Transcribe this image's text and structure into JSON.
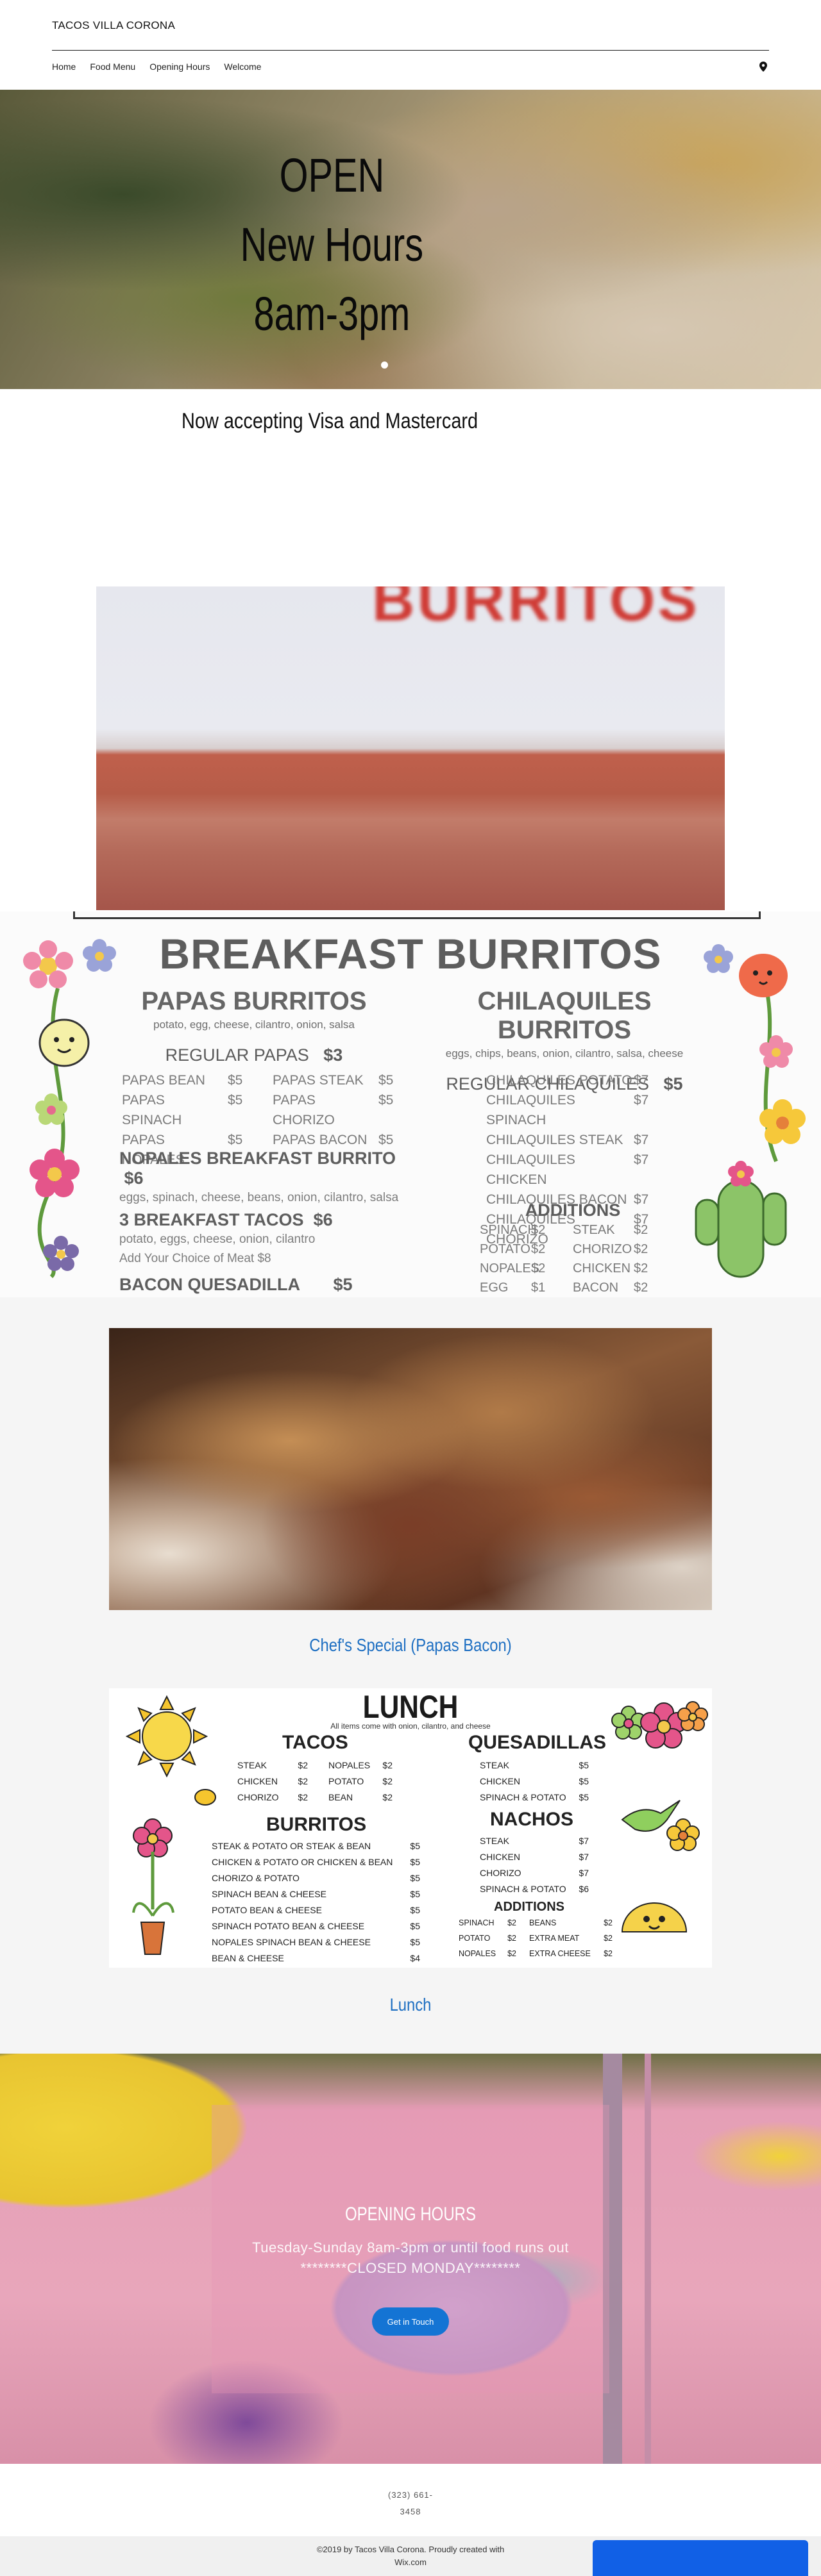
{
  "header": {
    "brand": "TACOS VILLA CORONA",
    "nav": [
      "Home",
      "Food Menu",
      "Opening Hours",
      "Welcome"
    ],
    "map_icon": "map-pin-icon"
  },
  "hero": {
    "line1": "OPEN",
    "line2": "New Hours",
    "line3": "8am-3pm"
  },
  "notice": "Now accepting Visa and Mastercard",
  "sign_image": {
    "word": "BURRITOS"
  },
  "breakfast_menu": {
    "title": "BREAKFAST BURRITOS",
    "papas": {
      "heading": "PAPAS BURRITOS",
      "note": "potato, egg, cheese, cilantro, onion, salsa",
      "sub_heading": "REGULAR PAPAS",
      "sub_price": "$3",
      "items_left": [
        {
          "name": "PAPAS BEAN",
          "price": "$5"
        },
        {
          "name": "PAPAS SPINACH",
          "price": "$5"
        },
        {
          "name": "PAPAS NOPALES",
          "price": "$5"
        }
      ],
      "items_right": [
        {
          "name": "PAPAS STEAK",
          "price": "$5"
        },
        {
          "name": "PAPAS CHORIZO",
          "price": "$5"
        },
        {
          "name": "PAPAS BACON",
          "price": "$5"
        }
      ],
      "nopales_name": "NOPALES BREAKFAST BURRITO",
      "nopales_price": "$6",
      "nopales_note": "eggs, spinach, cheese, beans, onion, cilantro, salsa",
      "tacos_name": "3 BREAKFAST TACOS",
      "tacos_price": "$6",
      "tacos_note1": "potato, eggs, cheese, onion, cilantro",
      "tacos_note2": "Add Your Choice of Meat $8",
      "quesadilla_name": "BACON QUESADILLA",
      "quesadilla_price": "$5"
    },
    "chilaquiles": {
      "heading": "CHILAQUILES BURRITOS",
      "note": "eggs, chips, beans, onion, cilantro, salsa, cheese",
      "sub_heading": "REGULAR CHILAQUILES",
      "sub_price": "$5",
      "items": [
        {
          "name": "CHILAQUILES POTATO",
          "price": "$7"
        },
        {
          "name": "CHILAQUILES SPINACH",
          "price": "$7"
        },
        {
          "name": "CHILAQUILES STEAK",
          "price": "$7"
        },
        {
          "name": "CHILAQUILES CHICKEN",
          "price": "$7"
        },
        {
          "name": "CHILAQUILES BACON",
          "price": "$7"
        },
        {
          "name": "CHILAQUILES CHORIZO",
          "price": "$7"
        }
      ],
      "additions_title": "ADDITIONS",
      "additions_left": [
        {
          "name": "SPINACH",
          "price": "$2"
        },
        {
          "name": "POTATO",
          "price": "$2"
        },
        {
          "name": "NOPALES",
          "price": "$2"
        },
        {
          "name": "EGG",
          "price": "$1"
        }
      ],
      "additions_right": [
        {
          "name": "STEAK",
          "price": "$2"
        },
        {
          "name": "CHORIZO",
          "price": "$2"
        },
        {
          "name": "CHICKEN",
          "price": "$2"
        },
        {
          "name": "BACON",
          "price": "$2"
        }
      ]
    }
  },
  "chef_special_caption": "Chef's Special (Papas Bacon)",
  "lunch_menu": {
    "title": "LUNCH",
    "subtitle": "All items come with onion, cilantro, and cheese",
    "tacos_title": "TACOS",
    "tacos_left": [
      {
        "name": "STEAK",
        "price": "$2"
      },
      {
        "name": "CHICKEN",
        "price": "$2"
      },
      {
        "name": "CHORIZO",
        "price": "$2"
      }
    ],
    "tacos_right": [
      {
        "name": "NOPALES",
        "price": "$2"
      },
      {
        "name": "POTATO",
        "price": "$2"
      },
      {
        "name": "BEAN",
        "price": "$2"
      }
    ],
    "burritos_title": "BURRITOS",
    "burritos": [
      {
        "name": "STEAK & POTATO OR STEAK & BEAN",
        "price": "$5"
      },
      {
        "name": "CHICKEN & POTATO OR CHICKEN & BEAN",
        "price": "$5"
      },
      {
        "name": "CHORIZO & POTATO",
        "price": "$5"
      },
      {
        "name": "SPINACH BEAN & CHEESE",
        "price": "$5"
      },
      {
        "name": "POTATO BEAN & CHEESE",
        "price": "$5"
      },
      {
        "name": "SPINACH POTATO BEAN & CHEESE",
        "price": "$5"
      },
      {
        "name": "NOPALES SPINACH BEAN & CHEESE",
        "price": "$5"
      },
      {
        "name": "BEAN & CHEESE",
        "price": "$4"
      }
    ],
    "quesadillas_title": "QUESADILLAS",
    "quesadillas": [
      {
        "name": "STEAK",
        "price": "$5"
      },
      {
        "name": "CHICKEN",
        "price": "$5"
      },
      {
        "name": "SPINACH & POTATO",
        "price": "$5"
      }
    ],
    "nachos_title": "NACHOS",
    "nachos": [
      {
        "name": "STEAK",
        "price": "$7"
      },
      {
        "name": "CHICKEN",
        "price": "$7"
      },
      {
        "name": "CHORIZO",
        "price": "$7"
      },
      {
        "name": "SPINACH & POTATO",
        "price": "$6"
      }
    ],
    "additions_title": "ADDITIONS",
    "additions_left": [
      {
        "name": "SPINACH",
        "price": "$2"
      },
      {
        "name": "POTATO",
        "price": "$2"
      },
      {
        "name": "NOPALES",
        "price": "$2"
      }
    ],
    "additions_right": [
      {
        "name": "BEANS",
        "price": "$2"
      },
      {
        "name": "EXTRA MEAT",
        "price": "$2"
      },
      {
        "name": "EXTRA CHEESE",
        "price": "$2"
      }
    ]
  },
  "lunch_caption": "Lunch",
  "hours": {
    "title": "OPENING HOURS",
    "line1": "Tuesday-Sunday 8am-3pm or until food runs out",
    "line2": "********CLOSED MONDAY********",
    "button": "Get in Touch"
  },
  "footer": {
    "phone_line1": "(323) 661-",
    "phone_line2": "3458",
    "credit_line1": "©2019 by Tacos Villa Corona. Proudly created with",
    "credit_line2": "Wix.com"
  },
  "colors": {
    "accent_blue": "#1e6fc2",
    "button_blue": "#1474d4",
    "menu_grey": "#5d5d5d"
  }
}
